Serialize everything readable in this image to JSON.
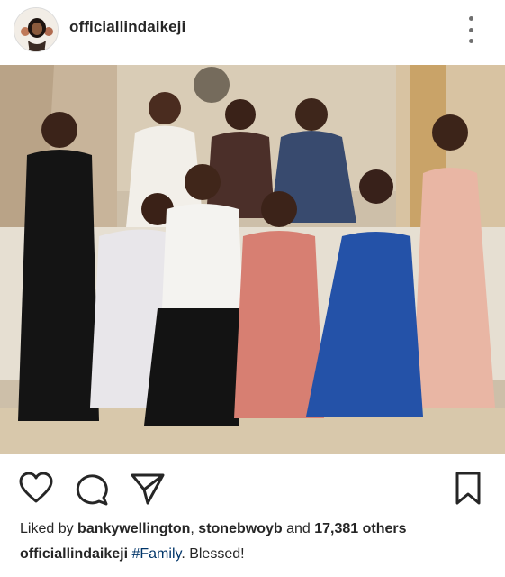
{
  "post": {
    "username": "officiallindaikeji",
    "image_alt": "Family portrait"
  },
  "likes": {
    "prefix": "Liked by",
    "user1": "bankywellington",
    "separator": ",",
    "user2": "stonebwoyb",
    "and_text": "and",
    "others_count": "17,381 others"
  },
  "caption": {
    "username": "officiallindaikeji",
    "hashtag": "#Family",
    "text": ". Blessed!"
  },
  "icons": {
    "more": "more-options-icon",
    "like": "heart-icon",
    "comment": "comment-bubble-icon",
    "share": "paper-plane-icon",
    "save": "bookmark-icon"
  },
  "colors": {
    "text": "#262626",
    "hashtag": "#003569",
    "icon": "#262626"
  }
}
